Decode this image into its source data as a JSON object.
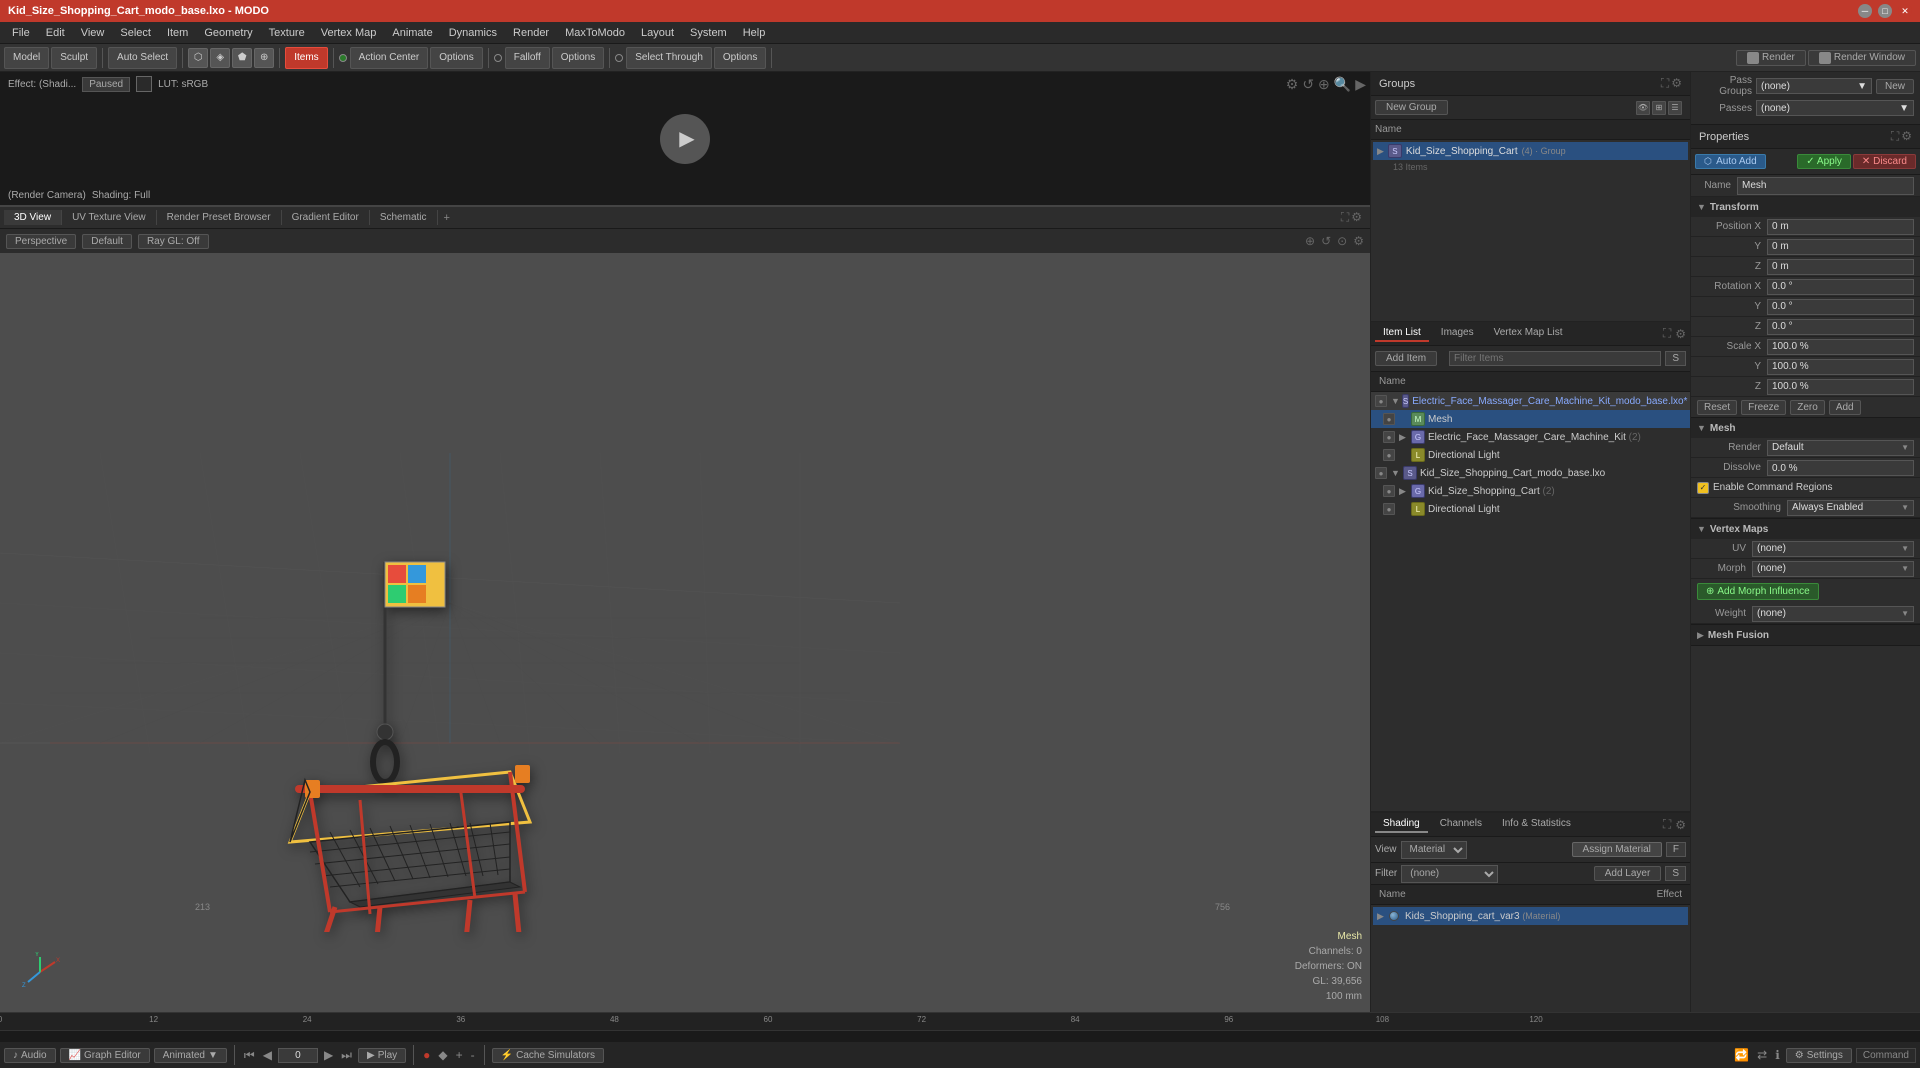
{
  "titlebar": {
    "title": "Kid_Size_Shopping_Cart_modo_base.lxo - MODO",
    "controls": [
      "minimize",
      "maximize",
      "close"
    ]
  },
  "menubar": {
    "items": [
      "File",
      "Edit",
      "View",
      "Select",
      "Item",
      "Geometry",
      "Texture",
      "Vertex Map",
      "Animate",
      "Dynamics",
      "Render",
      "MaxToModo",
      "Layout",
      "System",
      "Help"
    ]
  },
  "toolbar": {
    "model_label": "Model",
    "sculpt_label": "Sculpt",
    "auto_select_label": "Auto Select",
    "items_label": "Items",
    "action_center_label": "Action Center",
    "options_label": "Options",
    "falloff_label": "Falloff",
    "select_through_label": "Select Through",
    "options2_label": "Options",
    "render_label": "Render",
    "render_window_label": "Render Window"
  },
  "preview": {
    "effect_label": "Effect: (Shadi...",
    "status_label": "Paused",
    "lut_label": "LUT: sRGB",
    "camera_label": "(Render Camera)",
    "shading_label": "Shading: Full"
  },
  "viewport": {
    "tabs": [
      "3D View",
      "UV Texture View",
      "Render Preset Browser",
      "Gradient Editor",
      "Schematic"
    ],
    "perspective_label": "Perspective",
    "default_label": "Default",
    "ray_gl_label": "Ray GL: Off",
    "info": {
      "mesh": "Mesh",
      "channels": "Channels: 0",
      "deformers": "Deformers: ON",
      "gl": "GL: 39,656",
      "size": "100 mm"
    }
  },
  "groups": {
    "title": "Groups",
    "new_group_btn": "New Group",
    "col_name": "Name",
    "items": [
      {
        "name": "Kid_Size_Shopping_Cart",
        "count": "(4)",
        "type": "Group",
        "expanded": true
      }
    ],
    "sub_items": "13 Items"
  },
  "item_list": {
    "tabs": [
      "Item List",
      "Images",
      "Vertex Map List"
    ],
    "add_item_btn": "Add Item",
    "filter_placeholder": "Filter Items",
    "col_name": "Name",
    "sf_btn": "S",
    "items": [
      {
        "name": "Electric_Face_Massager_Care_Machine_Kit_modo_base.lxo*",
        "indent": 0,
        "type": "scene",
        "expanded": true,
        "visible": true
      },
      {
        "name": "Mesh",
        "indent": 1,
        "type": "mesh",
        "visible": true,
        "active": true
      },
      {
        "name": "Electric_Face_Massager_Care_Machine_Kit",
        "indent": 1,
        "type": "group",
        "count": "(2)",
        "expanded": false,
        "visible": true
      },
      {
        "name": "Directional Light",
        "indent": 1,
        "type": "light",
        "visible": true
      },
      {
        "name": "Kid_Size_Shopping_Cart_modo_base.lxo",
        "indent": 0,
        "type": "scene",
        "expanded": true,
        "visible": true
      },
      {
        "name": "Kid_Size_Shopping_Cart",
        "indent": 1,
        "type": "group",
        "count": "(2)",
        "expanded": false,
        "visible": true
      },
      {
        "name": "Directional Light",
        "indent": 1,
        "type": "light",
        "visible": true
      }
    ]
  },
  "shading": {
    "tabs": [
      "Shading",
      "Channels",
      "Info & Statistics"
    ],
    "view_label": "View",
    "view_value": "Material",
    "assign_btn": "Assign Material",
    "filter_label": "Filter",
    "filter_value": "(none)",
    "add_layer_btn": "Add Layer",
    "col_name": "Name",
    "col_effect": "Effect",
    "sf_btn": "S",
    "items": [
      {
        "name": "Kids_Shopping_cart_var3",
        "type": "Material",
        "visible": true
      }
    ]
  },
  "properties": {
    "title": "Properties",
    "auto_add_btn": "Auto Add",
    "apply_btn": "Apply",
    "discard_btn": "Discard",
    "name_label": "Name",
    "name_value": "Mesh",
    "transform_label": "Transform",
    "position_x_label": "Position X",
    "position_x_value": "0 m",
    "position_y_label": "Y",
    "position_y_value": "0 m",
    "position_z_label": "Z",
    "position_z_value": "0 m",
    "rotation_x_label": "Rotation X",
    "rotation_x_value": "0.0 °",
    "rotation_y_label": "Y",
    "rotation_y_value": "0.0 °",
    "rotation_z_label": "Z",
    "rotation_z_value": "0.0 °",
    "scale_x_label": "Scale X",
    "scale_x_value": "100.0 %",
    "scale_y_label": "Y",
    "scale_y_value": "100.0 %",
    "scale_z_label": "Z",
    "scale_z_value": "100.0 %",
    "reset_btn": "Reset",
    "freeze_btn": "Freeze",
    "zero_btn": "Zero",
    "add_btn": "Add",
    "mesh_label": "Mesh",
    "render_label": "Render",
    "render_value": "Default",
    "dissolve_label": "Dissolve",
    "dissolve_value": "0.0 %",
    "enable_regions_label": "Enable Command Regions",
    "smoothing_label": "Smoothing",
    "smoothing_value": "Always Enabled",
    "vertex_maps_label": "Vertex Maps",
    "uv_label": "UV",
    "uv_value": "(none)",
    "morph_label": "Morph",
    "morph_value": "(none)",
    "add_morph_btn": "Add Morph Influence",
    "weight_label": "Weight",
    "weight_value": "(none)",
    "mesh_fusion_label": "Mesh Fusion"
  },
  "pass_groups": {
    "pass_groups_label": "Pass Groups",
    "passes_label": "Passes",
    "value1": "(none)",
    "value2": "(none)",
    "new_btn": "New"
  },
  "timeline": {
    "audio_btn": "Audio",
    "graph_editor_btn": "Graph Editor",
    "animated_btn": "Animated",
    "frame_value": "0",
    "play_btn": "Play",
    "cache_btn": "Cache Simulators",
    "settings_btn": "Settings",
    "start": "0",
    "ruler_marks": [
      "0",
      "12",
      "24",
      "36",
      "48",
      "60",
      "72",
      "84",
      "96",
      "108",
      "120"
    ]
  }
}
